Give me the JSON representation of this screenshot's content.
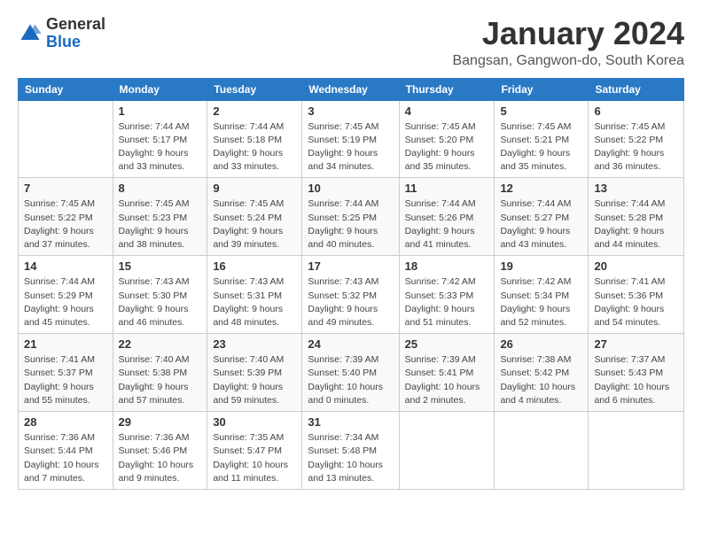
{
  "logo": {
    "general": "General",
    "blue": "Blue"
  },
  "title": "January 2024",
  "location": "Bangsan, Gangwon-do, South Korea",
  "days_of_week": [
    "Sunday",
    "Monday",
    "Tuesday",
    "Wednesday",
    "Thursday",
    "Friday",
    "Saturday"
  ],
  "weeks": [
    [
      {
        "day": "",
        "info": ""
      },
      {
        "day": "1",
        "info": "Sunrise: 7:44 AM\nSunset: 5:17 PM\nDaylight: 9 hours\nand 33 minutes."
      },
      {
        "day": "2",
        "info": "Sunrise: 7:44 AM\nSunset: 5:18 PM\nDaylight: 9 hours\nand 33 minutes."
      },
      {
        "day": "3",
        "info": "Sunrise: 7:45 AM\nSunset: 5:19 PM\nDaylight: 9 hours\nand 34 minutes."
      },
      {
        "day": "4",
        "info": "Sunrise: 7:45 AM\nSunset: 5:20 PM\nDaylight: 9 hours\nand 35 minutes."
      },
      {
        "day": "5",
        "info": "Sunrise: 7:45 AM\nSunset: 5:21 PM\nDaylight: 9 hours\nand 35 minutes."
      },
      {
        "day": "6",
        "info": "Sunrise: 7:45 AM\nSunset: 5:22 PM\nDaylight: 9 hours\nand 36 minutes."
      }
    ],
    [
      {
        "day": "7",
        "info": "Sunrise: 7:45 AM\nSunset: 5:22 PM\nDaylight: 9 hours\nand 37 minutes."
      },
      {
        "day": "8",
        "info": "Sunrise: 7:45 AM\nSunset: 5:23 PM\nDaylight: 9 hours\nand 38 minutes."
      },
      {
        "day": "9",
        "info": "Sunrise: 7:45 AM\nSunset: 5:24 PM\nDaylight: 9 hours\nand 39 minutes."
      },
      {
        "day": "10",
        "info": "Sunrise: 7:44 AM\nSunset: 5:25 PM\nDaylight: 9 hours\nand 40 minutes."
      },
      {
        "day": "11",
        "info": "Sunrise: 7:44 AM\nSunset: 5:26 PM\nDaylight: 9 hours\nand 41 minutes."
      },
      {
        "day": "12",
        "info": "Sunrise: 7:44 AM\nSunset: 5:27 PM\nDaylight: 9 hours\nand 43 minutes."
      },
      {
        "day": "13",
        "info": "Sunrise: 7:44 AM\nSunset: 5:28 PM\nDaylight: 9 hours\nand 44 minutes."
      }
    ],
    [
      {
        "day": "14",
        "info": "Sunrise: 7:44 AM\nSunset: 5:29 PM\nDaylight: 9 hours\nand 45 minutes."
      },
      {
        "day": "15",
        "info": "Sunrise: 7:43 AM\nSunset: 5:30 PM\nDaylight: 9 hours\nand 46 minutes."
      },
      {
        "day": "16",
        "info": "Sunrise: 7:43 AM\nSunset: 5:31 PM\nDaylight: 9 hours\nand 48 minutes."
      },
      {
        "day": "17",
        "info": "Sunrise: 7:43 AM\nSunset: 5:32 PM\nDaylight: 9 hours\nand 49 minutes."
      },
      {
        "day": "18",
        "info": "Sunrise: 7:42 AM\nSunset: 5:33 PM\nDaylight: 9 hours\nand 51 minutes."
      },
      {
        "day": "19",
        "info": "Sunrise: 7:42 AM\nSunset: 5:34 PM\nDaylight: 9 hours\nand 52 minutes."
      },
      {
        "day": "20",
        "info": "Sunrise: 7:41 AM\nSunset: 5:36 PM\nDaylight: 9 hours\nand 54 minutes."
      }
    ],
    [
      {
        "day": "21",
        "info": "Sunrise: 7:41 AM\nSunset: 5:37 PM\nDaylight: 9 hours\nand 55 minutes."
      },
      {
        "day": "22",
        "info": "Sunrise: 7:40 AM\nSunset: 5:38 PM\nDaylight: 9 hours\nand 57 minutes."
      },
      {
        "day": "23",
        "info": "Sunrise: 7:40 AM\nSunset: 5:39 PM\nDaylight: 9 hours\nand 59 minutes."
      },
      {
        "day": "24",
        "info": "Sunrise: 7:39 AM\nSunset: 5:40 PM\nDaylight: 10 hours\nand 0 minutes."
      },
      {
        "day": "25",
        "info": "Sunrise: 7:39 AM\nSunset: 5:41 PM\nDaylight: 10 hours\nand 2 minutes."
      },
      {
        "day": "26",
        "info": "Sunrise: 7:38 AM\nSunset: 5:42 PM\nDaylight: 10 hours\nand 4 minutes."
      },
      {
        "day": "27",
        "info": "Sunrise: 7:37 AM\nSunset: 5:43 PM\nDaylight: 10 hours\nand 6 minutes."
      }
    ],
    [
      {
        "day": "28",
        "info": "Sunrise: 7:36 AM\nSunset: 5:44 PM\nDaylight: 10 hours\nand 7 minutes."
      },
      {
        "day": "29",
        "info": "Sunrise: 7:36 AM\nSunset: 5:46 PM\nDaylight: 10 hours\nand 9 minutes."
      },
      {
        "day": "30",
        "info": "Sunrise: 7:35 AM\nSunset: 5:47 PM\nDaylight: 10 hours\nand 11 minutes."
      },
      {
        "day": "31",
        "info": "Sunrise: 7:34 AM\nSunset: 5:48 PM\nDaylight: 10 hours\nand 13 minutes."
      },
      {
        "day": "",
        "info": ""
      },
      {
        "day": "",
        "info": ""
      },
      {
        "day": "",
        "info": ""
      }
    ]
  ]
}
